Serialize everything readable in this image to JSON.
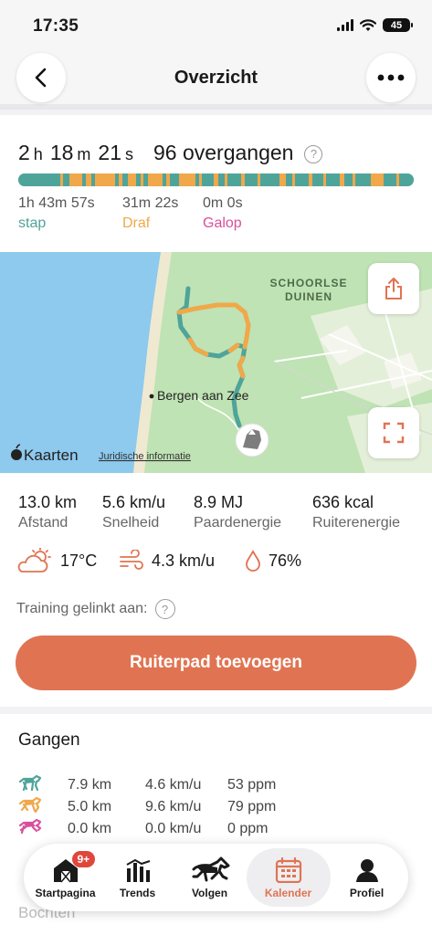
{
  "status": {
    "time": "17:35",
    "battery": "45"
  },
  "nav": {
    "title": "Overzicht"
  },
  "summary": {
    "hours": "2",
    "hours_unit": "h",
    "minutes": "18",
    "minutes_unit": "m",
    "seconds": "21",
    "seconds_unit": "s",
    "transitions": "96 overgangen"
  },
  "gaits": [
    {
      "time": "1h 43m 57s",
      "name": "stap",
      "color": "#4fa49a"
    },
    {
      "time": "31m 22s",
      "name": "Draf",
      "color": "#f0a84a"
    },
    {
      "time": "0m 0s",
      "name": "Galop",
      "color": "#d94f9e"
    }
  ],
  "map": {
    "place_label": "Bergen aan Zee",
    "area_label_line1": "SCHOORLSE",
    "area_label_line2": "DUINEN",
    "attribution_brand": "Kaarten",
    "attribution_link": "Juridische informatie"
  },
  "stats": [
    {
      "value": "13.0 km",
      "label": "Afstand"
    },
    {
      "value": "5.6 km/u",
      "label": "Snelheid"
    },
    {
      "value": "8.9 MJ",
      "label": "Paardenergie"
    },
    {
      "value": "636 kcal",
      "label": "Ruiterenergie"
    }
  ],
  "weather": {
    "temperature": "17°C",
    "wind": "4.3 km/u",
    "humidity": "76%"
  },
  "linked_label": "Training gelinkt aan:",
  "cta_label": "Ruiterpad toevoegen",
  "gangen": {
    "title": "Gangen",
    "rows": [
      {
        "distance": "7.9 km",
        "speed": "4.6 km/u",
        "rate": "53 ppm",
        "color": "#4fa49a"
      },
      {
        "distance": "5.0 km",
        "speed": "9.6 km/u",
        "rate": "79 ppm",
        "color": "#f0a84a"
      },
      {
        "distance": "0.0 km",
        "speed": "0.0 km/u",
        "rate": "0 ppm",
        "color": "#d94f9e"
      }
    ]
  },
  "next_section": "Bochten",
  "tabs": [
    {
      "label": "Startpagina",
      "badge": "9+"
    },
    {
      "label": "Trends"
    },
    {
      "label": "Volgen"
    },
    {
      "label": "Kalender",
      "active": true
    },
    {
      "label": "Profiel"
    }
  ],
  "colors": {
    "accent": "#e07452",
    "stap": "#4fa49a",
    "draf": "#f0a84a",
    "galop": "#d94f9e"
  }
}
